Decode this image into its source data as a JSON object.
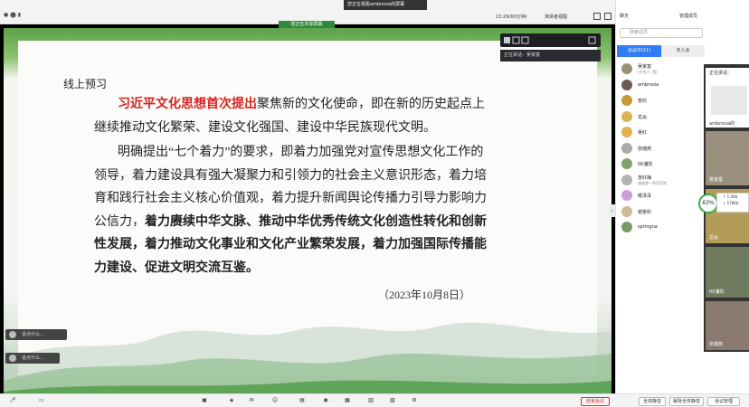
{
  "window": {
    "sharing_banner": "您正在观看ambrosia的屏幕",
    "timer": "13:29(60分钟)",
    "view_menu": "演讲者视图"
  },
  "share": {
    "label": "您正在共享屏幕",
    "speaking": "正在讲话：吴家富",
    "slide": {
      "header": "线上预习",
      "para1_red": "习近平文化思想首次提出",
      "para1_rest": "聚焦新的文化使命，即在新的历史起点上继续推动文化繁荣、建设文化强国、建设中华民族现代文明。",
      "para2_a": "明确提出“七个着力”的要求，即着力加强党对宣传思想文化工作的领导，着力建设具有强大凝聚力和引领力的社会主义意识形态，着力培育和践行社会主义核心价值观，着力提升新闻舆论传播力引导力影响力公信力，",
      "para2_bold": "着力赓续中华文脉、推动中华优秀传统文化创造性转化和创新性发展，着力推动文化事业和文化产业繁荣发展，着力加强国际传播能力建设、促进文明交流互鉴。",
      "date": "（2023年10月8日）"
    },
    "chips": [
      "说点什么...",
      "说点什么..."
    ]
  },
  "panel": {
    "tabs": [
      "聊天",
      "管理成员"
    ],
    "search_placeholder": "搜索成员",
    "seg_active": "会议中(11)",
    "seg_inactive": "未入会",
    "members": [
      {
        "name": "吴家富",
        "sub": "(主持人, 我)",
        "color": "#9b8f7a"
      },
      {
        "name": "ambrosia",
        "sub": "",
        "color": "#6b5a55"
      },
      {
        "name": "管欣",
        "sub": "",
        "color": "#c79a3a"
      },
      {
        "name": "龙焱",
        "sub": "",
        "color": "#d8b35a"
      },
      {
        "name": "吴红",
        "sub": "",
        "color": "#e0b24f"
      },
      {
        "name": "张璐燕",
        "sub": "",
        "color": "#aaa"
      },
      {
        "name": "00潘凯",
        "sub": "",
        "color": "#7fa56a"
      },
      {
        "name": "李红梅",
        "sub": "湖南第一师范学院",
        "color": "#b3b3b3"
      },
      {
        "name": "曜泽泽",
        "sub": "",
        "color": "#caa0d6"
      },
      {
        "name": "谢雯科",
        "sub": "",
        "color": "#cbb99a"
      },
      {
        "name": "springna",
        "sub": "",
        "color": "#7a9b65"
      }
    ]
  },
  "videos": {
    "speaking": "正在讲话：",
    "labels": [
      "ambrosia的",
      "吴家富",
      "龙焱",
      "00潘凯",
      "张璐燕"
    ],
    "network": "63%",
    "net_up": "↑ 1.2Kb",
    "net_down": "↓ 178Kb"
  },
  "bottom": {
    "end_meeting": "结束会议",
    "mute_all": "全体静音",
    "unmute_all": "解除全体静音",
    "manage": "会议管理"
  }
}
